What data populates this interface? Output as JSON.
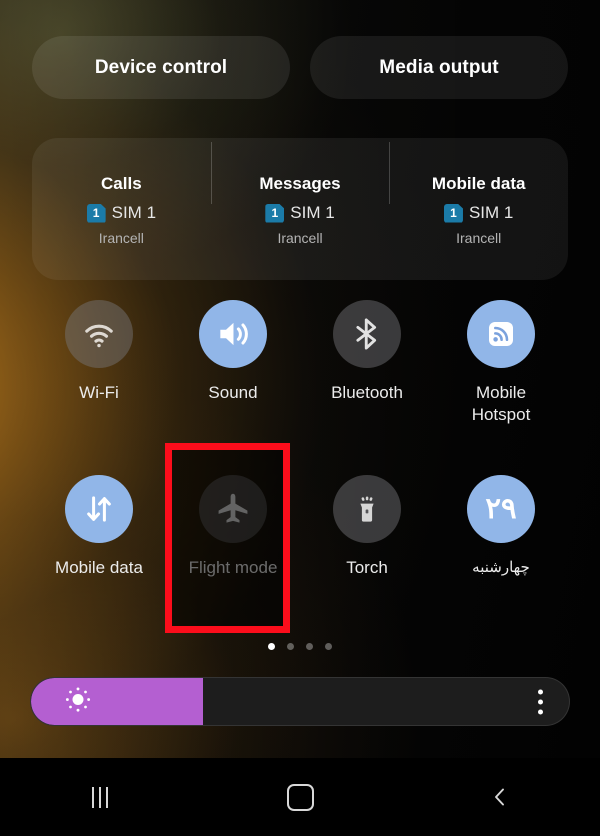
{
  "quick_panel": {
    "top_buttons": [
      {
        "label": "Device control",
        "name": "device-control-button"
      },
      {
        "label": "Media output",
        "name": "media-output-button"
      }
    ],
    "sim_card": {
      "columns": [
        {
          "title": "Calls",
          "badge": "1",
          "sim": "SIM 1",
          "carrier": "Irancell"
        },
        {
          "title": "Messages",
          "badge": "1",
          "sim": "SIM 1",
          "carrier": "Irancell"
        },
        {
          "title": "Mobile data",
          "badge": "1",
          "sim": "SIM 1",
          "carrier": "Irancell"
        }
      ]
    },
    "toggles": [
      {
        "label": "Wi-Fi",
        "icon": "wifi-icon",
        "state": "off"
      },
      {
        "label": "Sound",
        "icon": "sound-icon",
        "state": "on"
      },
      {
        "label": "Bluetooth",
        "icon": "bluetooth-icon",
        "state": "off"
      },
      {
        "label": "Mobile Hotspot",
        "icon": "mobile-hotspot-icon",
        "state": "on"
      },
      {
        "label": "Mobile data",
        "icon": "mobile-data-icon",
        "state": "on"
      },
      {
        "label": "Flight mode",
        "icon": "airplane-icon",
        "state": "off"
      },
      {
        "label": "Torch",
        "icon": "flashlight-icon",
        "state": "off"
      },
      {
        "label": "چهارشنبه",
        "icon": "calendar-date-icon",
        "state": "on",
        "date_number": "۲۹"
      }
    ],
    "highlight": {
      "target": "Flight mode",
      "color": "#fc0d1b"
    },
    "page_indicator": {
      "total": 4,
      "active_index": 0
    },
    "brightness": {
      "name": "brightness-slider",
      "value_percent": 32,
      "fill_color": "#b45fd1",
      "menu_icon": "more-options-icon",
      "sun_icon": "brightness-sun-icon"
    },
    "navigation_bar": [
      {
        "label": "Recents",
        "icon": "recents-icon"
      },
      {
        "label": "Home",
        "icon": "home-icon"
      },
      {
        "label": "Back",
        "icon": "back-icon"
      }
    ]
  },
  "colors": {
    "toggle_on": "#91b6e8",
    "toggle_off": "rgba(120,120,124,0.46)",
    "sim_badge": "#1b7ba8"
  }
}
